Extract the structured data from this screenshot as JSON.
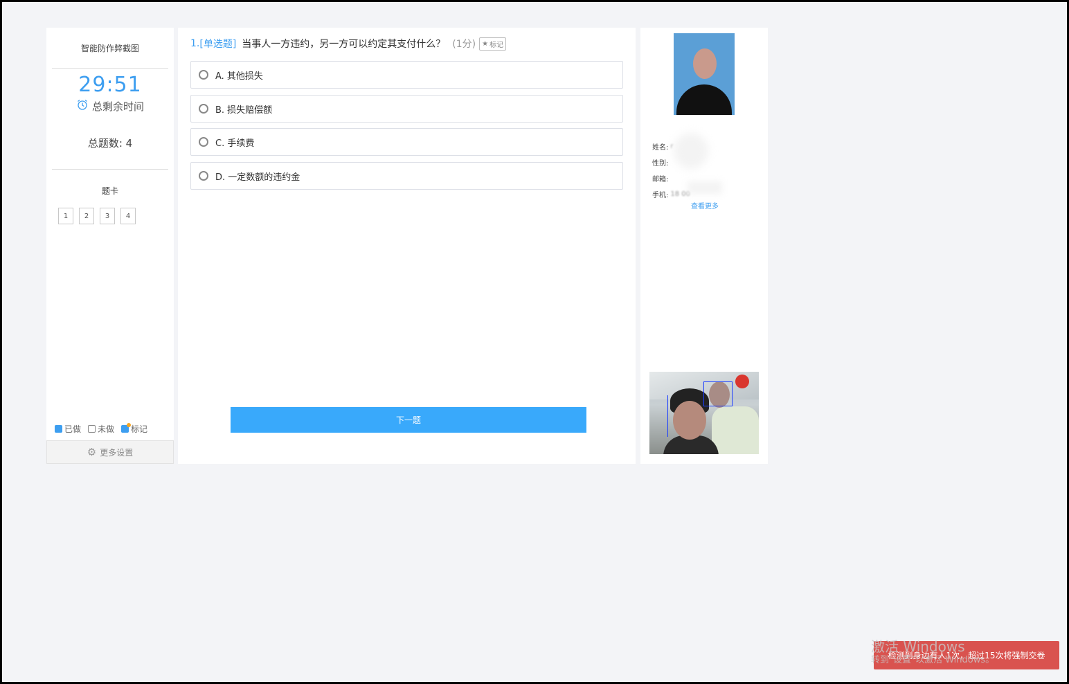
{
  "sidebar": {
    "title": "智能防作弊截图",
    "timer": "29:51",
    "timer_label": "总剩余时间",
    "total_questions_label": "总题数: 4",
    "card_title": "题卡",
    "card_numbers": [
      "1",
      "2",
      "3",
      "4"
    ],
    "legend": {
      "done": "已做",
      "undone": "未做",
      "marked": "标记"
    },
    "settings_label": "更多设置"
  },
  "question": {
    "number": "1.",
    "type": "[单选题]",
    "text": "当事人一方违约，另一方可以约定其支付什么？",
    "score": "(1分)",
    "mark_label": "标记",
    "options": [
      "A. 其他损失",
      "B. 损失赔偿额",
      "C. 手续费",
      "D. 一定数额的违约金"
    ],
    "next_label": "下一题"
  },
  "profile": {
    "name_label": "姓名:",
    "name_value": "r",
    "gender_label": "性别:",
    "email_label": "邮箱:",
    "phone_label": "手机:",
    "phone_value": "18      00",
    "more_link": "查看更多"
  },
  "toast": "检测到身边有人1次，超过15次将强制交卷",
  "watermark": {
    "line1": "激活 Windows",
    "line2": "转到\"设置\"以激活 Windows。"
  },
  "colors": {
    "accent": "#3d9ef0",
    "button": "#39a9fb",
    "alert": "#d9534f",
    "background": "#f3f4f7"
  },
  "icons": {
    "timer": "alarm-clock-icon",
    "settings": "gear-icon",
    "mark": "star-icon"
  }
}
